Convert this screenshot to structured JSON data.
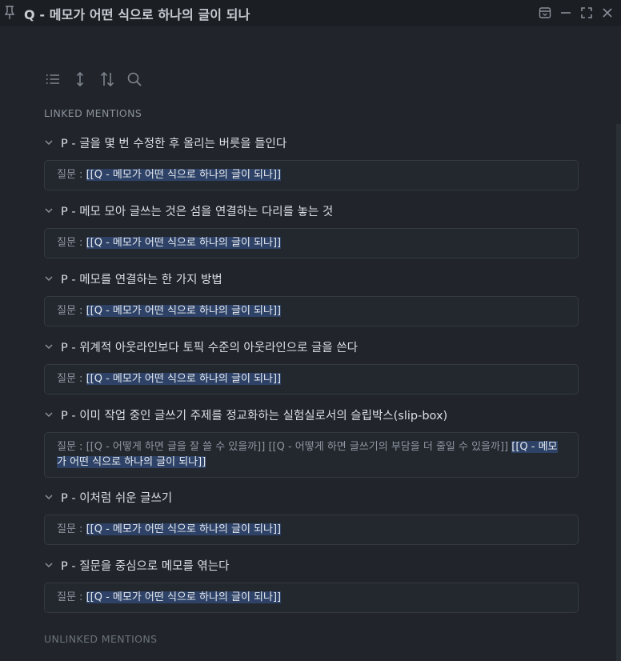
{
  "window": {
    "title": "Q - 메모가 어떤 식으로 하나의 글이 되나"
  },
  "sections": {
    "linked": "LINKED MENTIONS",
    "unlinked": "UNLINKED MENTIONS"
  },
  "mentions": [
    {
      "title": "P - 글을 몇 번 수정한 후 올리는 버릇을 들인다",
      "label": "질문 : ",
      "link": "[[Q - 메모가 어떤 식으로 하나의 글이 되나]]"
    },
    {
      "title": "P - 메모 모아 글쓰는 것은 섬을 연결하는 다리를 놓는 것",
      "label": "질문 : ",
      "link": "[[Q - 메모가 어떤 식으로 하나의 글이 되나]]"
    },
    {
      "title": "P - 메모를 연결하는 한 가지 방법",
      "label": "질문 : ",
      "link": "[[Q - 메모가 어떤 식으로 하나의 글이 되나]]"
    },
    {
      "title": "P - 위계적 아웃라인보다 토픽 수준의 아웃라인으로 글을 쓴다",
      "label": "질문 : ",
      "link": "[[Q - 메모가 어떤 식으로 하나의 글이 되나]]"
    },
    {
      "title": "P - 이미 작업 중인 글쓰기 주제를 정교화하는 실험실로서의 슬립박스(slip-box)",
      "label": "질문 : ",
      "other_link_1": "[[Q - 어떻게 하면 글을 잘 쓸 수 있을까]]",
      "other_link_2": "[[Q - 어떻게 하면 글쓰기의 부담을 더 줄일 수 있을까]]",
      "link": "[[Q - 메모가 어떤 식으로 하나의 글이 되나]]"
    },
    {
      "title": "P - 이처럼 쉬운 글쓰기",
      "label": "질문 : ",
      "link": "[[Q - 메모가 어떤 식으로 하나의 글이 되나]]"
    },
    {
      "title": "P - 질문을 중심으로 메모를 엮는다",
      "label": "질문 : ",
      "link": "[[Q - 메모가 어떤 식으로 하나의 글이 되나]]"
    }
  ],
  "icons": {
    "pin": "pin-icon",
    "archive": "archive-icon",
    "minimize": "minimize-icon",
    "maximize": "maximize-icon",
    "close": "close-icon",
    "list": "list-icon",
    "expand": "expand-vertical-icon",
    "sort": "sort-icon",
    "search": "search-icon",
    "chevron": "chevron-down-icon"
  }
}
